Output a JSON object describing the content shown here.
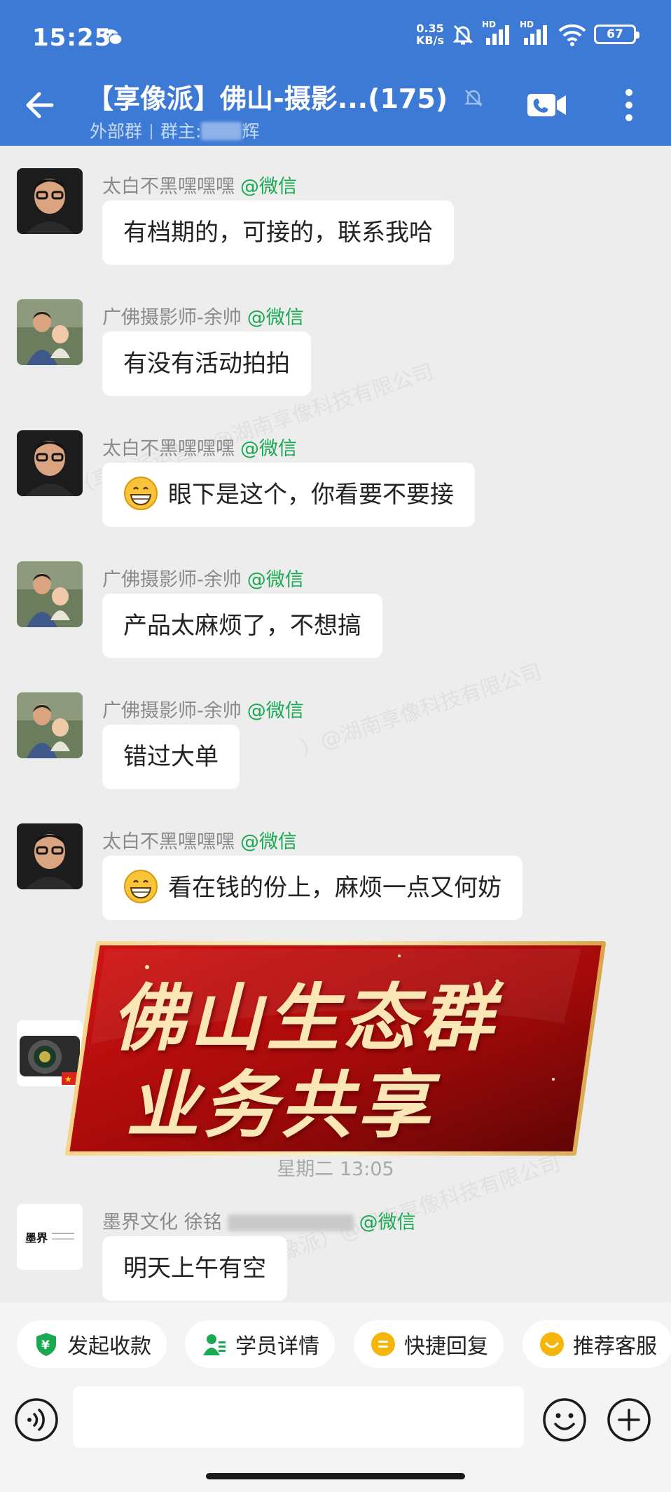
{
  "status_bar": {
    "time": "15:25",
    "net_speed_value": "0.35",
    "net_speed_unit": "KB/s",
    "signal1_label": "HD",
    "signal2_label": "HD",
    "battery": "67"
  },
  "header": {
    "title": "【享像派】佛山-摄影...(175)",
    "group_type": "外部群",
    "owner_prefix": "群主:",
    "owner_suffix": "辉"
  },
  "messages": [
    {
      "sender": "太白不黑嘿嘿嘿",
      "tag": "@微信",
      "text": "有档期的，可接的，联系我哈",
      "avatar": "man-glasses"
    },
    {
      "sender": "广佛摄影师-余帅",
      "tag": "@微信",
      "text": "有没有活动拍拍",
      "avatar": "father-baby"
    },
    {
      "sender": "太白不黑嘿嘿嘿",
      "tag": "@微信",
      "text": "眼下是这个，你看要不要接",
      "avatar": "man-glasses",
      "emoji": "grin"
    },
    {
      "sender": "广佛摄影师-余帅",
      "tag": "@微信",
      "text": "产品太麻烦了，不想搞",
      "avatar": "father-baby"
    },
    {
      "sender": "广佛摄影师-余帅",
      "tag": "@微信",
      "text": "错过大单",
      "avatar": "father-baby"
    },
    {
      "sender": "太白不黑嘿嘿嘿",
      "tag": "@微信",
      "text": "看在钱的份上，麻烦一点又何妨",
      "avatar": "man-glasses",
      "emoji": "grin"
    },
    {
      "sender": "墨界文化 徐铭",
      "tag": "@微信",
      "text": "明天上午有空",
      "avatar": "ink-logo"
    }
  ],
  "banner": {
    "line1": "佛山生态群",
    "line2": "业务共享"
  },
  "timestamp": "星期二 13:05",
  "quick_actions": [
    {
      "label": "发起收款",
      "icon": "payment-icon",
      "color": "#18a952"
    },
    {
      "label": "学员详情",
      "icon": "student-icon",
      "color": "#18a952"
    },
    {
      "label": "快捷回复",
      "icon": "quick-reply-icon",
      "color": "#f5b50a"
    },
    {
      "label": "推荐客服",
      "icon": "service-icon",
      "color": "#f5b50a"
    }
  ],
  "colors": {
    "header_bg": "#3d7ad6",
    "wechat_tag": "#18a952",
    "chat_bg": "#ededed"
  }
}
